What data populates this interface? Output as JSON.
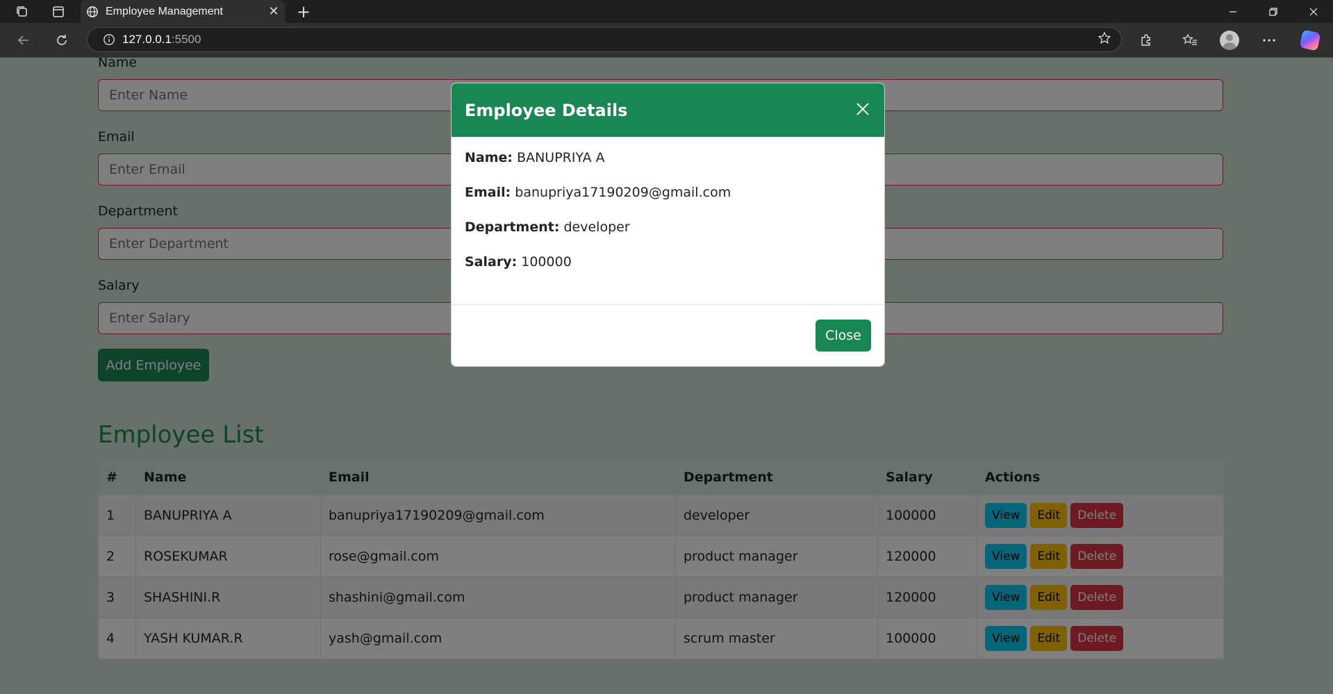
{
  "browser": {
    "tab_title": "Employee Management",
    "tab_close": "✕",
    "new_tab": "+",
    "url_host": "127.0.0.1",
    "url_port": ":5500"
  },
  "form": {
    "name_label": "Name",
    "name_placeholder": "Enter Name",
    "email_label": "Email",
    "email_placeholder": "Enter Email",
    "department_label": "Department",
    "department_placeholder": "Enter Department",
    "salary_label": "Salary",
    "salary_placeholder": "Enter Salary",
    "add_button": "Add Employee"
  },
  "list": {
    "title": "Employee List",
    "headers": [
      "#",
      "Name",
      "Email",
      "Department",
      "Salary",
      "Actions"
    ],
    "rows": [
      {
        "num": "1",
        "name": "BANUPRIYA A",
        "email": "banupriya17190209@gmail.com",
        "department": "developer",
        "salary": "100000"
      },
      {
        "num": "2",
        "name": "ROSEKUMAR",
        "email": "rose@gmail.com",
        "department": "product manager",
        "salary": "120000"
      },
      {
        "num": "3",
        "name": "SHASHINI.R",
        "email": "shashini@gmail.com",
        "department": "product manager",
        "salary": "120000"
      },
      {
        "num": "4",
        "name": "YASH KUMAR.R",
        "email": "yash@gmail.com",
        "department": "scrum master",
        "salary": "100000"
      }
    ],
    "actions": {
      "view": "View",
      "edit": "Edit",
      "delete": "Delete"
    }
  },
  "modal": {
    "title": "Employee Details",
    "close_x": "×",
    "name_label": "Name:",
    "name_value": "BANUPRIYA A",
    "email_label": "Email:",
    "email_value": "banupriya17190209@gmail.com",
    "department_label": "Department:",
    "department_value": "developer",
    "salary_label": "Salary:",
    "salary_value": "100000",
    "close_button": "Close"
  },
  "colors": {
    "primary_green": "#198754",
    "danger": "#dc3545",
    "info": "#0dcaf0",
    "warning": "#ffc107",
    "page_bg": "#cfe3d3"
  },
  "icons": [
    "workspaces-icon",
    "tab-actions-icon",
    "globe-icon",
    "back-arrow-icon",
    "refresh-icon",
    "info-icon",
    "star-icon",
    "extensions-icon",
    "favorites-icon",
    "profile-icon",
    "more-icon",
    "copilot-icon",
    "minimize-icon",
    "restore-icon",
    "close-window-icon"
  ]
}
